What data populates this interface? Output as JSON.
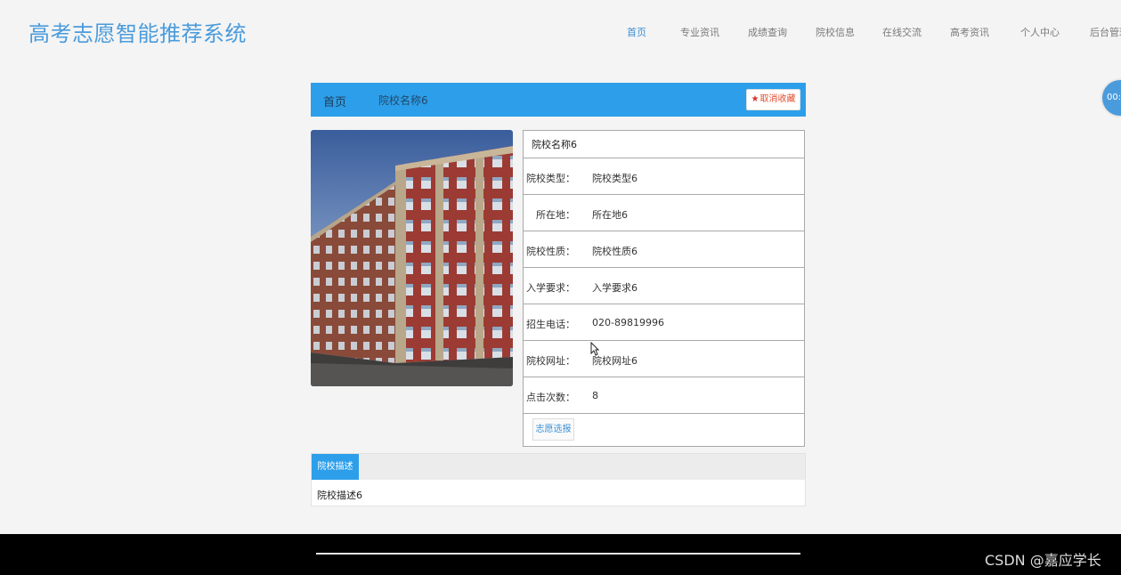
{
  "header": {
    "site_title": "高考志愿智能推荐系统",
    "nav": [
      {
        "label": "首页",
        "active": true
      },
      {
        "label": "专业资讯",
        "active": false
      },
      {
        "label": "成绩查询",
        "active": false
      },
      {
        "label": "院校信息",
        "active": false
      },
      {
        "label": "在线交流",
        "active": false
      },
      {
        "label": "高考资讯",
        "active": false
      },
      {
        "label": "个人中心",
        "active": false
      },
      {
        "label": "后台管理",
        "active": false
      }
    ]
  },
  "float_widget": {
    "text": "00:"
  },
  "breadcrumb": {
    "home": "首页",
    "current": "院校名称6"
  },
  "favorite_button": {
    "icon": "star-icon",
    "label": "取消收藏"
  },
  "school": {
    "name": "院校名称6",
    "fields": [
      {
        "label": "院校类型：",
        "value": "院校类型6"
      },
      {
        "label": "所在地：",
        "value": "所在地6"
      },
      {
        "label": "院校性质：",
        "value": "院校性质6"
      },
      {
        "label": "入学要求：",
        "value": "入学要求6"
      },
      {
        "label": "招生电话：",
        "value": "020-89819996"
      },
      {
        "label": "院校网址：",
        "value": "院校网址6"
      },
      {
        "label": "点击次数：",
        "value": "8"
      }
    ],
    "apply_button": "志愿选报"
  },
  "description": {
    "tab": "院校描述",
    "text": "院校描述6"
  },
  "footer": {
    "watermark": "CSDN @嘉应学长"
  },
  "colors": {
    "accent": "#2d9fea",
    "logo": "#4a9bdc",
    "favorite": "#e24b2b",
    "footer": "#000000"
  }
}
